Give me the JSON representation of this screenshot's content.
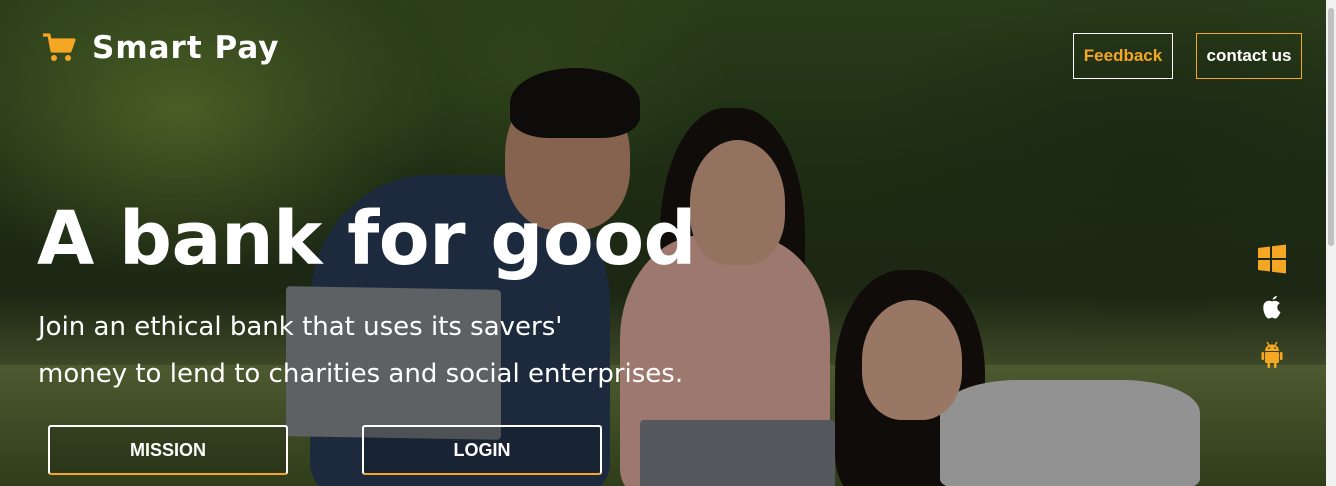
{
  "brand": {
    "name": "Smart Pay",
    "icon": "shopping-cart-icon"
  },
  "nav": {
    "feedback_label": "Feedback",
    "contact_label": "contact us"
  },
  "hero": {
    "headline": "A bank for good",
    "subtext_line1": "Join an ethical bank that uses its savers'",
    "subtext_line2": "money to lend to charities and social enterprises."
  },
  "actions": {
    "mission_label": "MISSION",
    "login_label": "LOGIN"
  },
  "platforms": [
    {
      "name": "windows-icon"
    },
    {
      "name": "apple-icon"
    },
    {
      "name": "android-icon"
    }
  ],
  "colors": {
    "accent": "#f5a623",
    "text": "#ffffff"
  }
}
